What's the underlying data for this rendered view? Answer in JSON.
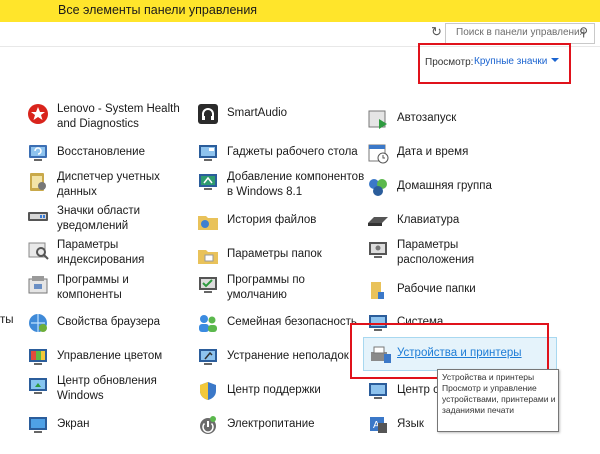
{
  "window": {
    "title": "Все элементы панели управления"
  },
  "search": {
    "placeholder": "Поиск в панели управления"
  },
  "view": {
    "label": "Просмотр:",
    "selected": "Крупные значки"
  },
  "col1": [
    {
      "l1": "Lenovo - System Health",
      "l2": "and Diagnostics",
      "icon": "lenovo-health-icon"
    },
    {
      "l1": "Восстановление",
      "icon": "recovery-icon"
    },
    {
      "l1": "Диспетчер учетных",
      "l2": "данных",
      "icon": "credential-manager-icon"
    },
    {
      "l1": "Значки области",
      "l2": "уведомлений",
      "icon": "notification-icons-icon"
    },
    {
      "l1": "Параметры",
      "l2": "индексирования",
      "icon": "indexing-icon"
    },
    {
      "l1": "Программы и",
      "l2": "компоненты",
      "icon": "programs-icon"
    },
    {
      "l1": "Свойства браузера",
      "icon": "internet-options-icon"
    },
    {
      "l1": "Управление цветом",
      "icon": "color-management-icon"
    },
    {
      "l1": "Центр обновления",
      "l2": "Windows",
      "icon": "windows-update-icon"
    },
    {
      "l1": "Экран",
      "icon": "display-icon"
    }
  ],
  "col2": [
    {
      "l1": "SmartAudio",
      "icon": "smartaudio-icon"
    },
    {
      "l1": "Гаджеты рабочего стола",
      "icon": "desktop-gadgets-icon"
    },
    {
      "l1": "Добавление компонентов",
      "l2": "в Windows 8.1",
      "icon": "add-features-icon"
    },
    {
      "l1": "История файлов",
      "icon": "file-history-icon"
    },
    {
      "l1": "Параметры папок",
      "icon": "folder-options-icon"
    },
    {
      "l1": "Программы по",
      "l2": "умолчанию",
      "icon": "default-programs-icon"
    },
    {
      "l1": "Семейная безопасность",
      "icon": "family-safety-icon"
    },
    {
      "l1": "Устранение неполадок",
      "icon": "troubleshooting-icon"
    },
    {
      "l1": "Центр поддержки",
      "icon": "action-center-icon"
    },
    {
      "l1": "Электропитание",
      "icon": "power-options-icon"
    }
  ],
  "col3": [
    {
      "l1": "Автозапуск",
      "icon": "autoplay-icon"
    },
    {
      "l1": "Дата и время",
      "icon": "date-time-icon"
    },
    {
      "l1": "Домашняя группа",
      "icon": "homegroup-icon"
    },
    {
      "l1": "Клавиатура",
      "icon": "keyboard-icon"
    },
    {
      "l1": "Параметры",
      "l2": "расположения",
      "icon": "location-icon"
    },
    {
      "l1": "Рабочие папки",
      "icon": "work-folders-icon"
    },
    {
      "l1": "Система",
      "icon": "system-icon"
    },
    {
      "l1": "Устройства и принтеры",
      "icon": "devices-printers-icon"
    },
    {
      "l1": "Центр с",
      "icon": "network-center-icon"
    },
    {
      "l1": "Язык",
      "icon": "language-icon"
    }
  ],
  "left_edge": {
    "l1": "ты"
  },
  "tooltip": {
    "line1": "Устройства и принтеры",
    "line2": "Просмотр и управление",
    "line3": "устройствами, принтерами и",
    "line4": "заданиями печати"
  }
}
